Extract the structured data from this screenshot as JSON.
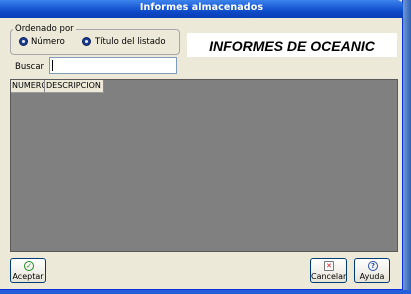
{
  "window": {
    "title": "Informes almacenados"
  },
  "order_group": {
    "legend": "Ordenado por",
    "options": [
      {
        "label": "Número",
        "selected": true
      },
      {
        "label": "Título del listado",
        "selected": false
      }
    ]
  },
  "banner": {
    "text": "INFORMES DE OCEANIC"
  },
  "search": {
    "label": "Buscar",
    "value": ""
  },
  "grid": {
    "columns": [
      "NUMERO",
      "DESCRIPCION"
    ],
    "rows": []
  },
  "buttons": {
    "accept": {
      "label": "Aceptar",
      "icon": "check-icon"
    },
    "cancel": {
      "label": "Cancelar",
      "icon": "cancel-icon"
    },
    "help": {
      "label": "Ayuda",
      "icon": "help-icon"
    }
  },
  "colors": {
    "titlebar": "#0c47c4",
    "grid_background": "#808080",
    "window_background": "#ece9d8"
  }
}
